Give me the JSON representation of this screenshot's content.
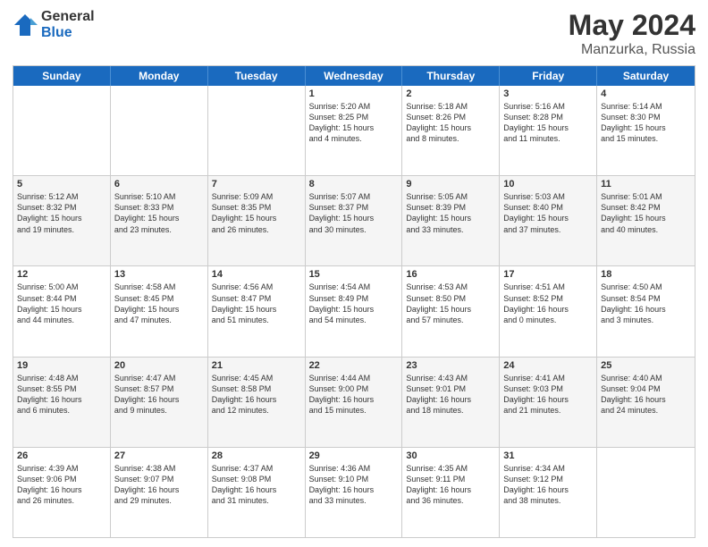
{
  "logo": {
    "general": "General",
    "blue": "Blue"
  },
  "title": {
    "month": "May 2024",
    "location": "Manzurka, Russia"
  },
  "header_days": [
    "Sunday",
    "Monday",
    "Tuesday",
    "Wednesday",
    "Thursday",
    "Friday",
    "Saturday"
  ],
  "rows": [
    {
      "alt": false,
      "cells": [
        {
          "day": "",
          "detail": ""
        },
        {
          "day": "",
          "detail": ""
        },
        {
          "day": "",
          "detail": ""
        },
        {
          "day": "1",
          "detail": "Sunrise: 5:20 AM\nSunset: 8:25 PM\nDaylight: 15 hours\nand 4 minutes."
        },
        {
          "day": "2",
          "detail": "Sunrise: 5:18 AM\nSunset: 8:26 PM\nDaylight: 15 hours\nand 8 minutes."
        },
        {
          "day": "3",
          "detail": "Sunrise: 5:16 AM\nSunset: 8:28 PM\nDaylight: 15 hours\nand 11 minutes."
        },
        {
          "day": "4",
          "detail": "Sunrise: 5:14 AM\nSunset: 8:30 PM\nDaylight: 15 hours\nand 15 minutes."
        }
      ]
    },
    {
      "alt": true,
      "cells": [
        {
          "day": "5",
          "detail": "Sunrise: 5:12 AM\nSunset: 8:32 PM\nDaylight: 15 hours\nand 19 minutes."
        },
        {
          "day": "6",
          "detail": "Sunrise: 5:10 AM\nSunset: 8:33 PM\nDaylight: 15 hours\nand 23 minutes."
        },
        {
          "day": "7",
          "detail": "Sunrise: 5:09 AM\nSunset: 8:35 PM\nDaylight: 15 hours\nand 26 minutes."
        },
        {
          "day": "8",
          "detail": "Sunrise: 5:07 AM\nSunset: 8:37 PM\nDaylight: 15 hours\nand 30 minutes."
        },
        {
          "day": "9",
          "detail": "Sunrise: 5:05 AM\nSunset: 8:39 PM\nDaylight: 15 hours\nand 33 minutes."
        },
        {
          "day": "10",
          "detail": "Sunrise: 5:03 AM\nSunset: 8:40 PM\nDaylight: 15 hours\nand 37 minutes."
        },
        {
          "day": "11",
          "detail": "Sunrise: 5:01 AM\nSunset: 8:42 PM\nDaylight: 15 hours\nand 40 minutes."
        }
      ]
    },
    {
      "alt": false,
      "cells": [
        {
          "day": "12",
          "detail": "Sunrise: 5:00 AM\nSunset: 8:44 PM\nDaylight: 15 hours\nand 44 minutes."
        },
        {
          "day": "13",
          "detail": "Sunrise: 4:58 AM\nSunset: 8:45 PM\nDaylight: 15 hours\nand 47 minutes."
        },
        {
          "day": "14",
          "detail": "Sunrise: 4:56 AM\nSunset: 8:47 PM\nDaylight: 15 hours\nand 51 minutes."
        },
        {
          "day": "15",
          "detail": "Sunrise: 4:54 AM\nSunset: 8:49 PM\nDaylight: 15 hours\nand 54 minutes."
        },
        {
          "day": "16",
          "detail": "Sunrise: 4:53 AM\nSunset: 8:50 PM\nDaylight: 15 hours\nand 57 minutes."
        },
        {
          "day": "17",
          "detail": "Sunrise: 4:51 AM\nSunset: 8:52 PM\nDaylight: 16 hours\nand 0 minutes."
        },
        {
          "day": "18",
          "detail": "Sunrise: 4:50 AM\nSunset: 8:54 PM\nDaylight: 16 hours\nand 3 minutes."
        }
      ]
    },
    {
      "alt": true,
      "cells": [
        {
          "day": "19",
          "detail": "Sunrise: 4:48 AM\nSunset: 8:55 PM\nDaylight: 16 hours\nand 6 minutes."
        },
        {
          "day": "20",
          "detail": "Sunrise: 4:47 AM\nSunset: 8:57 PM\nDaylight: 16 hours\nand 9 minutes."
        },
        {
          "day": "21",
          "detail": "Sunrise: 4:45 AM\nSunset: 8:58 PM\nDaylight: 16 hours\nand 12 minutes."
        },
        {
          "day": "22",
          "detail": "Sunrise: 4:44 AM\nSunset: 9:00 PM\nDaylight: 16 hours\nand 15 minutes."
        },
        {
          "day": "23",
          "detail": "Sunrise: 4:43 AM\nSunset: 9:01 PM\nDaylight: 16 hours\nand 18 minutes."
        },
        {
          "day": "24",
          "detail": "Sunrise: 4:41 AM\nSunset: 9:03 PM\nDaylight: 16 hours\nand 21 minutes."
        },
        {
          "day": "25",
          "detail": "Sunrise: 4:40 AM\nSunset: 9:04 PM\nDaylight: 16 hours\nand 24 minutes."
        }
      ]
    },
    {
      "alt": false,
      "cells": [
        {
          "day": "26",
          "detail": "Sunrise: 4:39 AM\nSunset: 9:06 PM\nDaylight: 16 hours\nand 26 minutes."
        },
        {
          "day": "27",
          "detail": "Sunrise: 4:38 AM\nSunset: 9:07 PM\nDaylight: 16 hours\nand 29 minutes."
        },
        {
          "day": "28",
          "detail": "Sunrise: 4:37 AM\nSunset: 9:08 PM\nDaylight: 16 hours\nand 31 minutes."
        },
        {
          "day": "29",
          "detail": "Sunrise: 4:36 AM\nSunset: 9:10 PM\nDaylight: 16 hours\nand 33 minutes."
        },
        {
          "day": "30",
          "detail": "Sunrise: 4:35 AM\nSunset: 9:11 PM\nDaylight: 16 hours\nand 36 minutes."
        },
        {
          "day": "31",
          "detail": "Sunrise: 4:34 AM\nSunset: 9:12 PM\nDaylight: 16 hours\nand 38 minutes."
        },
        {
          "day": "",
          "detail": ""
        }
      ]
    }
  ]
}
